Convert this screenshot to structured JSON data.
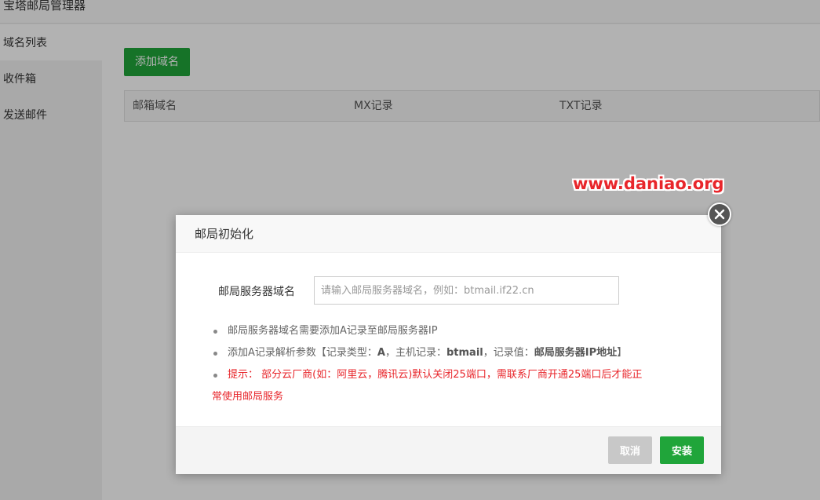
{
  "app": {
    "title": "宝塔邮局管理器"
  },
  "sidebar": {
    "items": [
      {
        "label": "域名列表",
        "active": true
      },
      {
        "label": "收件箱",
        "active": false
      },
      {
        "label": "发送邮件",
        "active": false
      }
    ]
  },
  "main": {
    "add_button": "添加域名",
    "table": {
      "columns": [
        "邮箱域名",
        "MX记录",
        "TXT记录"
      ]
    }
  },
  "watermark": "www.daniao.org",
  "modal": {
    "title": "邮局初始化",
    "field_label": "邮局服务器域名",
    "field_value": "",
    "field_placeholder": "请输入邮局服务器域名，例如：btmail.if22.cn",
    "note1": "邮局服务器域名需要添加A记录至邮局服务器IP",
    "note2": {
      "p1": "添加A记录解析参数【记录类型：",
      "type": "A",
      "p2": "，主机记录：",
      "host": "btmail",
      "p3": "，记录值：",
      "value": "邮局服务器IP地址",
      "p4": "】"
    },
    "note3": {
      "line1": "提示： 部分云厂商(如：阿里云，腾讯云)默认关闭25端口，需联系厂商开通25端口后才能正",
      "line2": "常使用邮局服务"
    },
    "cancel_label": "取消",
    "install_label": "安装"
  },
  "colors": {
    "accent_green": "#20a53a",
    "warning_red": "#e8262b",
    "cancel_gray": "#c8c8c8"
  }
}
